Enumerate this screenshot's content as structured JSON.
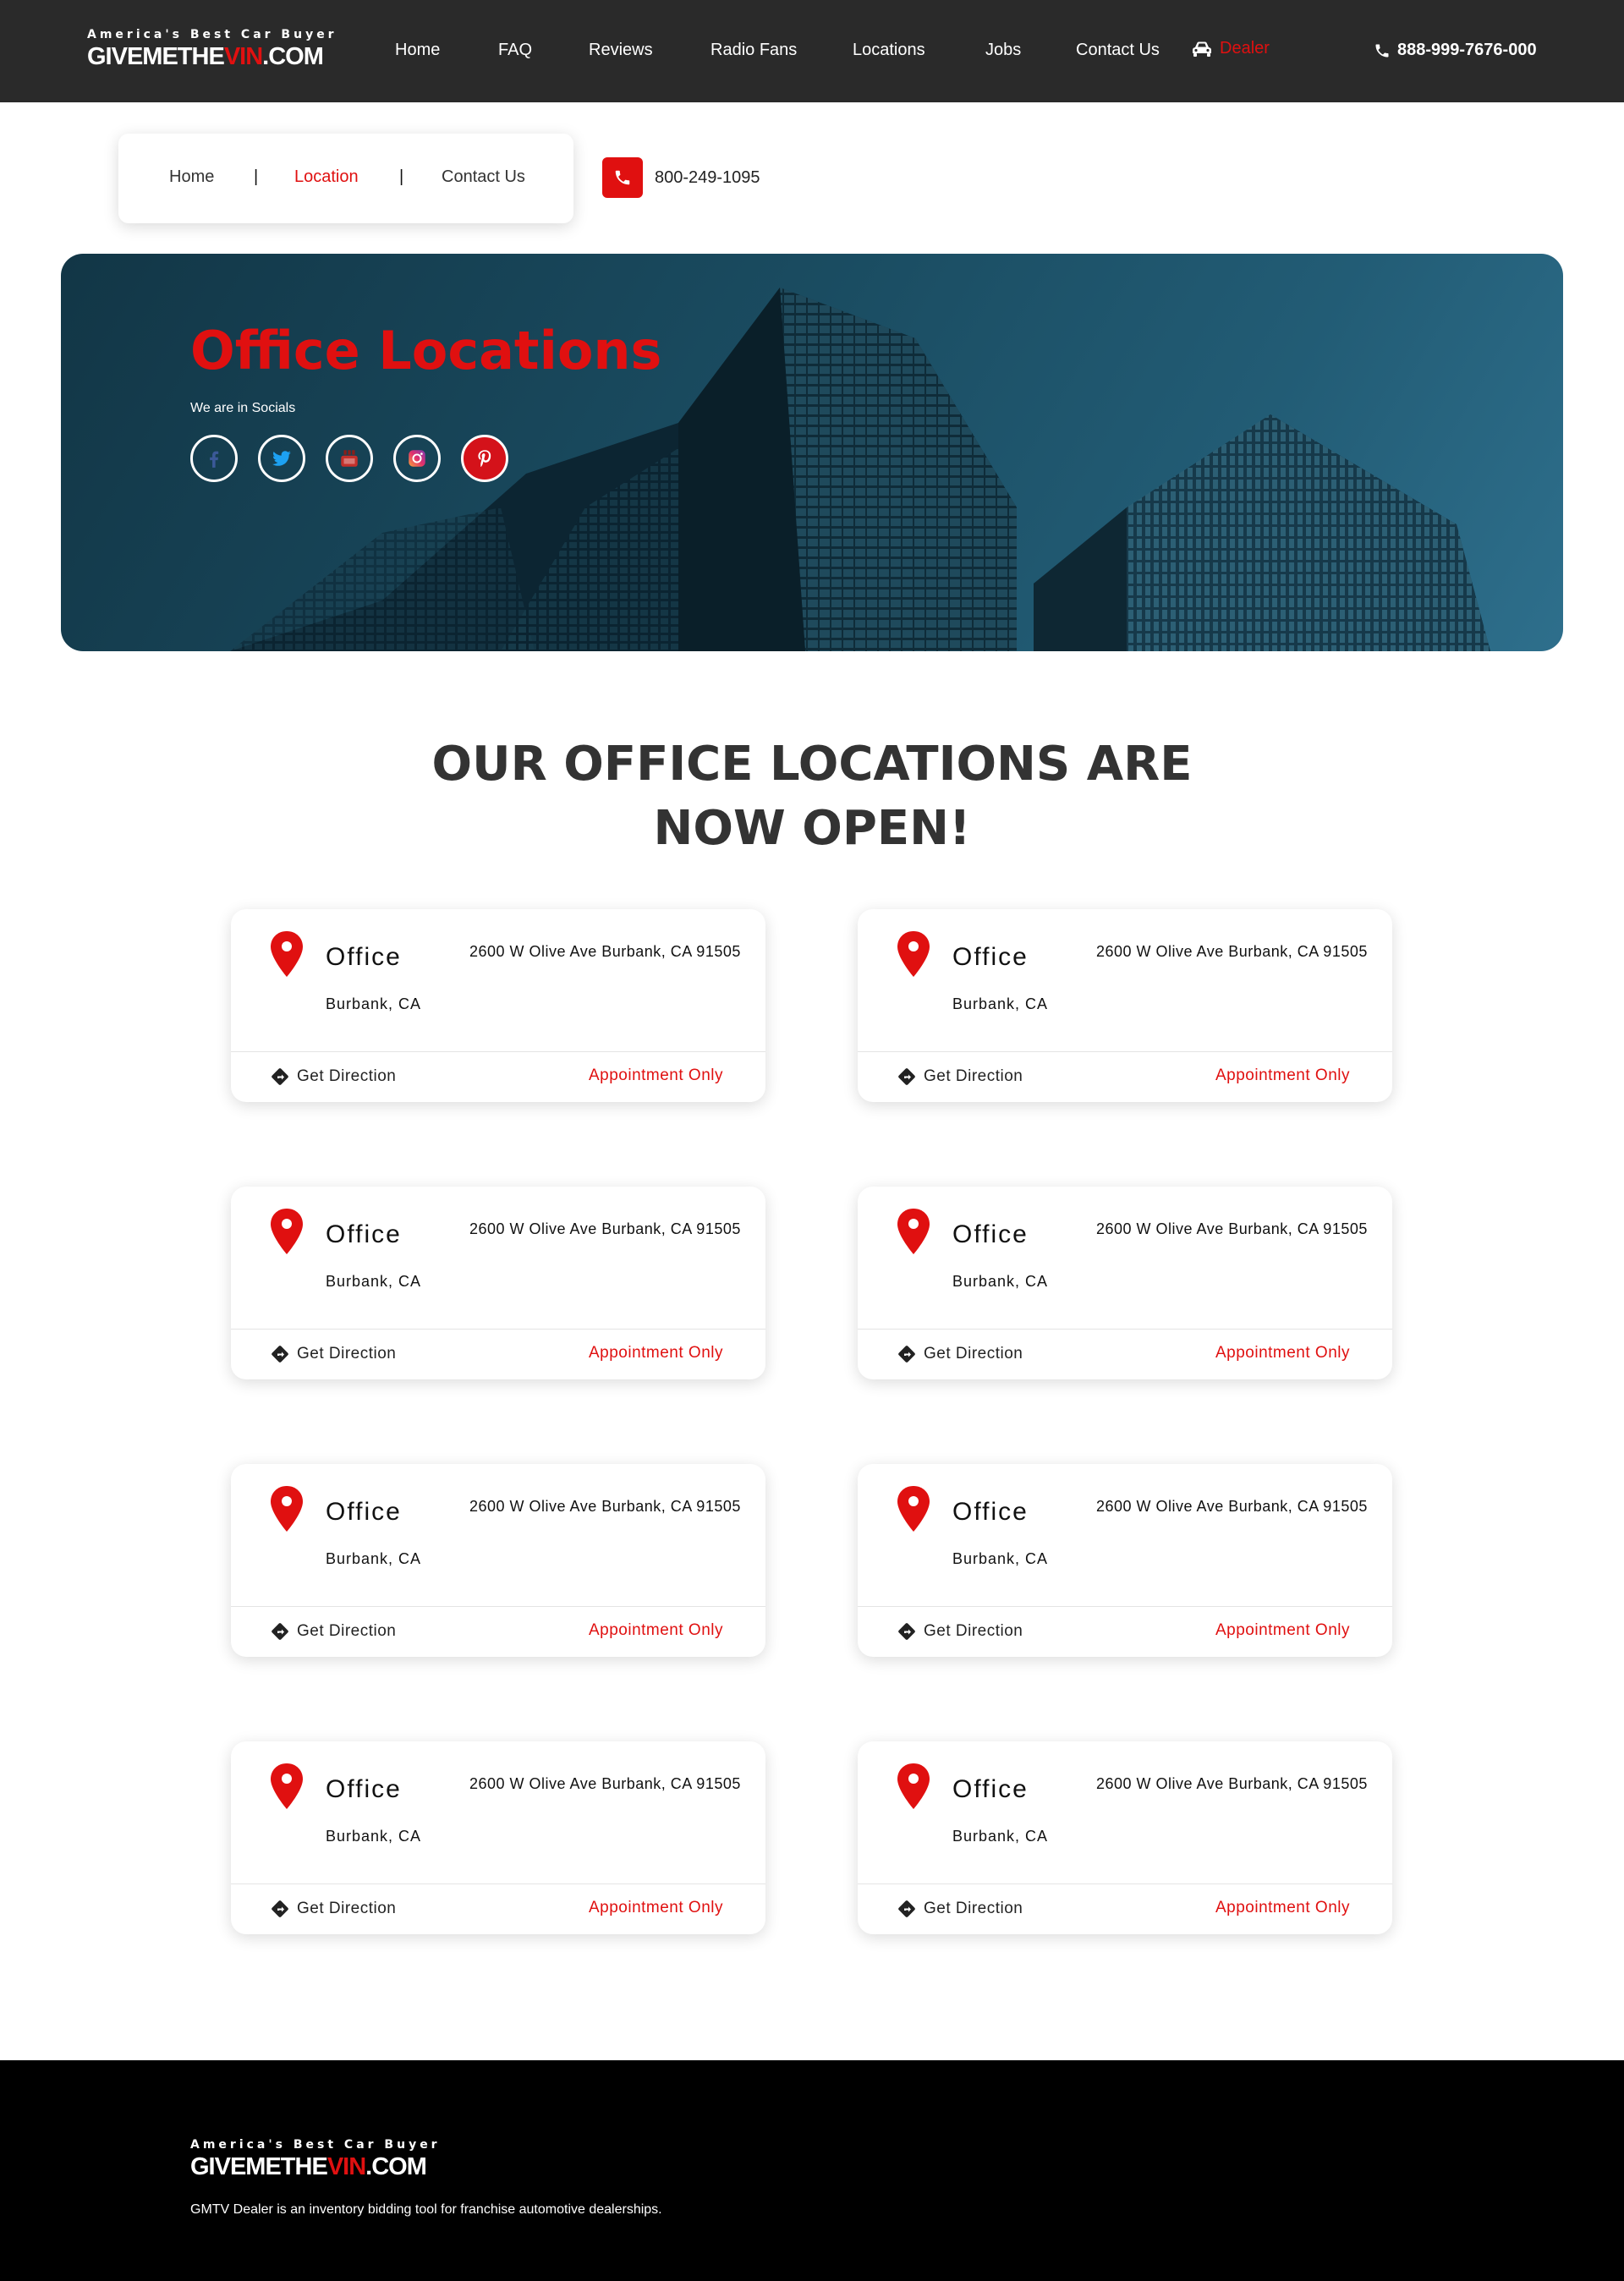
{
  "header": {
    "logo_tagline": "America's Best Car Buyer",
    "logo_brand_pre": "GIVEMETHE",
    "logo_brand_vin": "VIN",
    "logo_brand_post": ".COM",
    "nav": [
      "Home",
      "FAQ",
      "Reviews",
      "Radio Fans",
      "Locations",
      "Jobs",
      "Contact Us"
    ],
    "dealer_label": "Dealer",
    "phone": "888-999-7676-000"
  },
  "breadcrumb": {
    "items": [
      "Home",
      "Location",
      "Contact Us"
    ],
    "separator": "|",
    "active": "Location",
    "phone": "800-249-1095"
  },
  "hero": {
    "title": "Office Locations",
    "subtitle": "We are in Socials",
    "socials": [
      "facebook",
      "twitter",
      "youtube",
      "instagram",
      "pinterest"
    ]
  },
  "section": {
    "heading_line1": "OUR OFFICE LOCATIONS ARE",
    "heading_line2": "NOW OPEN!"
  },
  "offices": [
    {
      "name": "Office",
      "city": "Burbank, CA",
      "address": "2600 W Olive Ave Burbank, CA 91505",
      "direction_label": "Get Direction",
      "note": "Appointment Only"
    },
    {
      "name": "Office",
      "city": "Burbank, CA",
      "address": "2600 W Olive Ave Burbank, CA 91505",
      "direction_label": "Get Direction",
      "note": "Appointment Only"
    },
    {
      "name": "Office",
      "city": "Burbank, CA",
      "address": "2600 W Olive Ave Burbank, CA 91505",
      "direction_label": "Get Direction",
      "note": "Appointment Only"
    },
    {
      "name": "Office",
      "city": "Burbank, CA",
      "address": "2600 W Olive Ave Burbank, CA 91505",
      "direction_label": "Get Direction",
      "note": "Appointment Only"
    },
    {
      "name": "Office",
      "city": "Burbank, CA",
      "address": "2600 W Olive Ave Burbank, CA 91505",
      "direction_label": "Get Direction",
      "note": "Appointment Only"
    },
    {
      "name": "Office",
      "city": "Burbank, CA",
      "address": "2600 W Olive Ave Burbank, CA 91505",
      "direction_label": "Get Direction",
      "note": "Appointment Only"
    },
    {
      "name": "Office",
      "city": "Burbank, CA",
      "address": "2600 W Olive Ave Burbank, CA 91505",
      "direction_label": "Get Direction",
      "note": "Appointment Only"
    },
    {
      "name": "Office",
      "city": "Burbank, CA",
      "address": "2600 W Olive Ave Burbank, CA 91505",
      "direction_label": "Get Direction",
      "note": "Appointment Only"
    }
  ],
  "footer": {
    "logo_tagline": "America's Best Car Buyer",
    "logo_brand_pre": "GIVEMETHE",
    "logo_brand_vin": "VIN",
    "logo_brand_post": ".COM",
    "description": "GMTV Dealer is an inventory bidding tool for franchise automotive dealerships."
  },
  "colors": {
    "accent_red": "#e01010",
    "topbar": "#2a2a2a",
    "footer": "#000000",
    "hero_blue": "#1a4c61"
  }
}
